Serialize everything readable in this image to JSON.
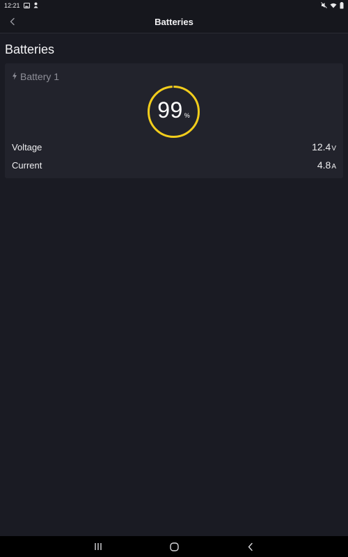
{
  "status_bar": {
    "time": "12:21",
    "icons_left": [
      "image-icon",
      "person-pin-icon"
    ],
    "icons_right": [
      "mute-icon",
      "wifi-icon",
      "battery-icon"
    ]
  },
  "header": {
    "title": "Batteries",
    "back_icon": "chevron-left-icon"
  },
  "page": {
    "title": "Batteries"
  },
  "battery": {
    "name": "Battery 1",
    "icon": "bolt-icon",
    "charge_value": "99",
    "charge_unit": "%",
    "charge_fraction": 0.99,
    "ring_color": "#f2cd1b",
    "metrics": [
      {
        "label": "Voltage",
        "value": "12.4",
        "unit": "V"
      },
      {
        "label": "Current",
        "value": "4.8",
        "unit": "A"
      }
    ]
  },
  "nav_bar": {
    "buttons": [
      "recent-apps-icon",
      "home-icon",
      "back-icon"
    ]
  },
  "colors": {
    "background": "#1a1b23",
    "card": "#22232c",
    "accent": "#f2cd1b"
  }
}
